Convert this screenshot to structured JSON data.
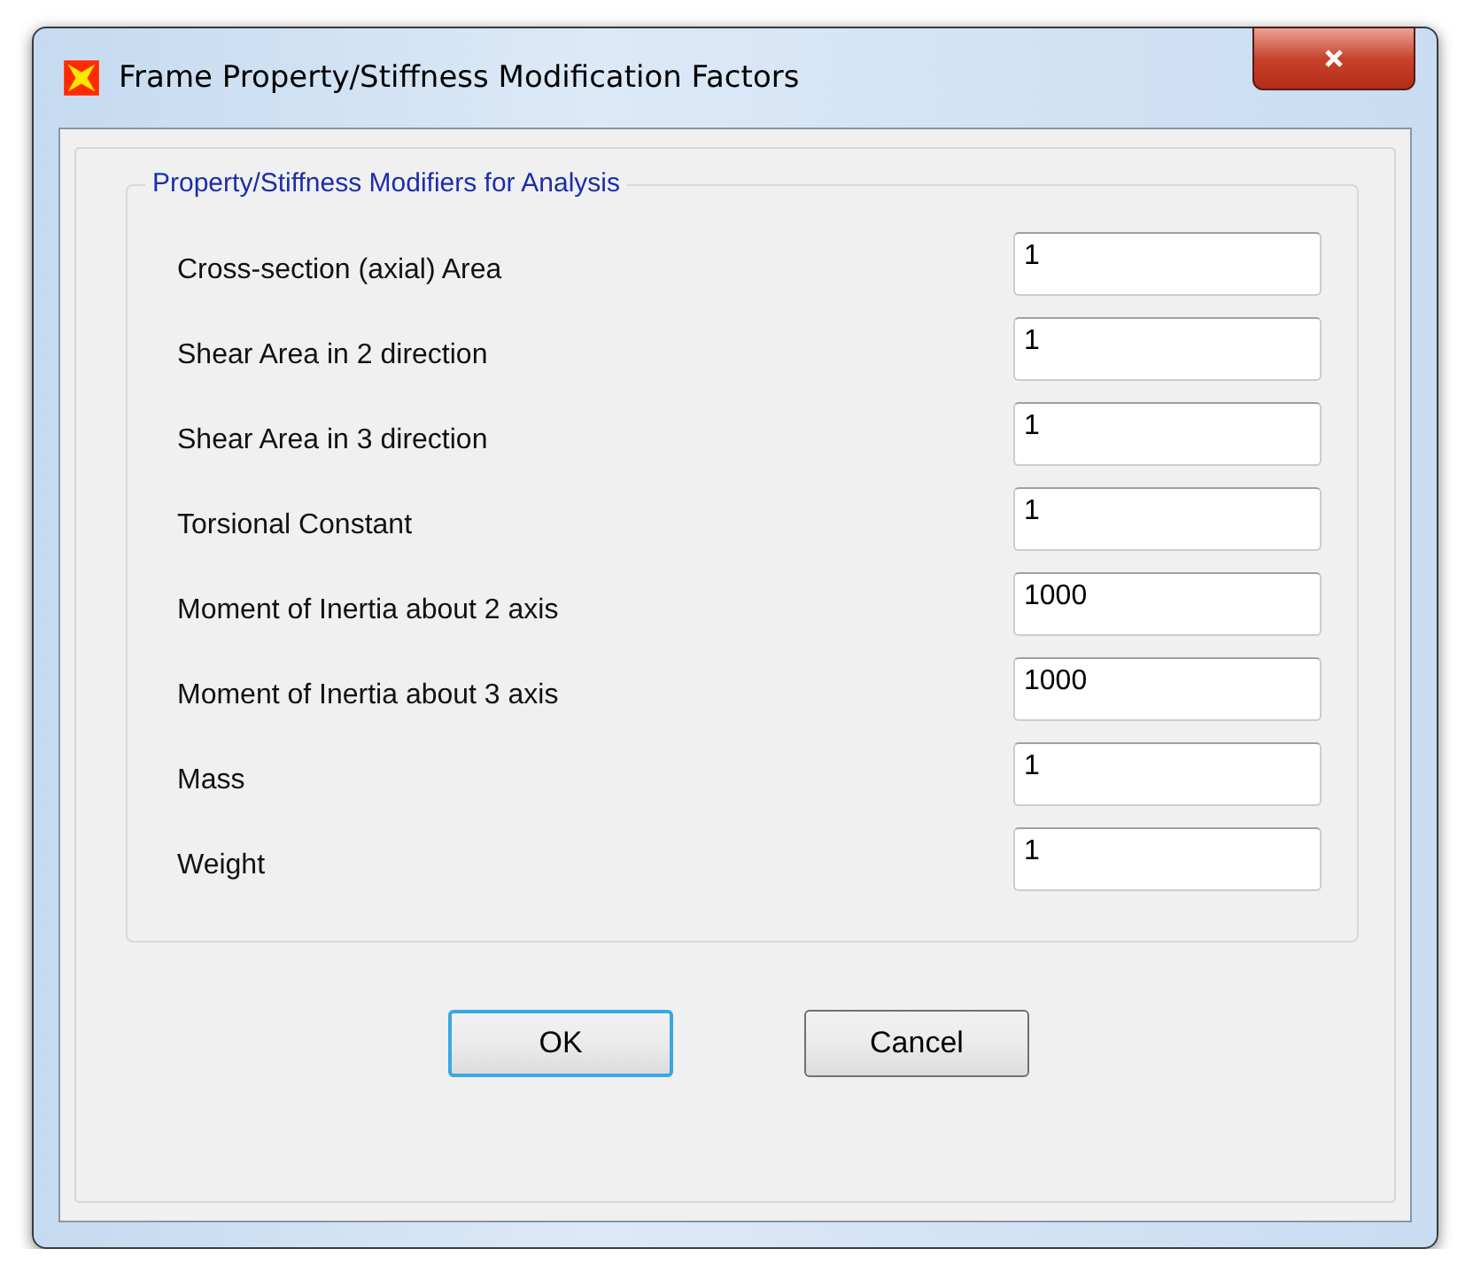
{
  "window": {
    "title": "Frame Property/Stiffness Modification Factors"
  },
  "group": {
    "title": "Property/Stiffness Modifiers for Analysis",
    "fields": [
      {
        "label": "Cross-section (axial) Area",
        "value": "1"
      },
      {
        "label": "Shear Area in 2 direction",
        "value": "1"
      },
      {
        "label": "Shear Area in 3 direction",
        "value": "1"
      },
      {
        "label": "Torsional Constant",
        "value": "1"
      },
      {
        "label": "Moment of Inertia about 2 axis",
        "value": "1000"
      },
      {
        "label": "Moment of Inertia about 3 axis",
        "value": "1000"
      },
      {
        "label": "Mass",
        "value": "1"
      },
      {
        "label": "Weight",
        "value": "1"
      }
    ]
  },
  "buttons": [
    {
      "label": "OK",
      "default": true
    },
    {
      "label": "Cancel",
      "default": false
    }
  ]
}
